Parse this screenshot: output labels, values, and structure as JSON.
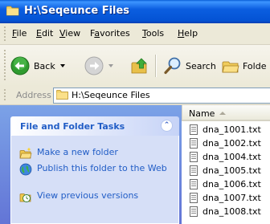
{
  "window": {
    "title": "H:\\Seqeunce Files"
  },
  "menu": {
    "items": [
      {
        "label": "File",
        "key": "F"
      },
      {
        "label": "Edit",
        "key": "E"
      },
      {
        "label": "View",
        "key": "V"
      },
      {
        "label": "Favorites",
        "key": "a"
      },
      {
        "label": "Tools",
        "key": "T"
      },
      {
        "label": "Help",
        "key": "H"
      }
    ]
  },
  "toolbar": {
    "back_label": "Back",
    "search_label": "Search",
    "folders_label": "Folde"
  },
  "address": {
    "label": "Address",
    "value": "H:\\Seqeunce Files"
  },
  "tasks": {
    "title": "File and Folder Tasks",
    "items": [
      {
        "label": "Make a new folder",
        "icon": "new-folder-icon"
      },
      {
        "label": "Publish this folder to the Web",
        "icon": "publish-web-icon"
      },
      {
        "label": "View previous versions",
        "icon": "previous-versions-icon"
      }
    ]
  },
  "files": {
    "column_name": "Name",
    "items": [
      "dna_1001.txt",
      "dna_1002.txt",
      "dna_1004.txt",
      "dna_1005.txt",
      "dna_1006.txt",
      "dna_1007.txt",
      "dna_1008.txt"
    ]
  },
  "colors": {
    "title_blue": "#0453d4",
    "task_link": "#215dc6",
    "task_bg": "#d6dff7",
    "sidebar_bg": "#7ba2e7"
  }
}
